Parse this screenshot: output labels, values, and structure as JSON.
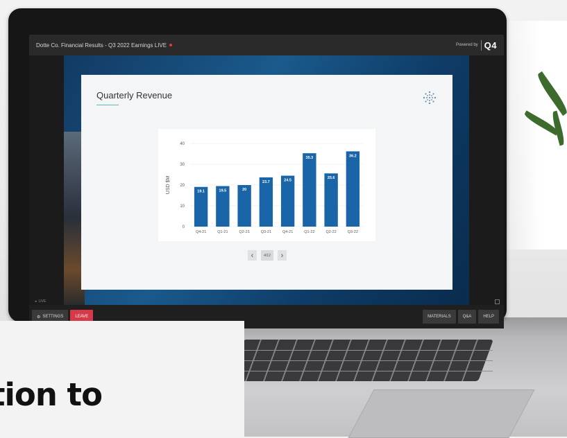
{
  "event": {
    "title": "Dotte Co. Financial Results - Q3 2022 Earnings LIVE",
    "powered_by": "Powered by",
    "provider_logo": "Q4"
  },
  "slide": {
    "title": "Quarterly Revenue",
    "brand_icon": "snowflake-logo-icon",
    "page_indicator": "4/12",
    "prev_icon": "chevron-left-icon",
    "next_icon": "chevron-right-icon"
  },
  "chart_data": {
    "type": "bar",
    "title": "",
    "xlabel": "",
    "ylabel": "USD $M",
    "categories": [
      "Q4-21",
      "Q1-21",
      "Q2-21",
      "Q3-21",
      "Q4-21",
      "Q1-22",
      "Q2-22",
      "Q3-22"
    ],
    "values": [
      19.1,
      19.5,
      20,
      23.7,
      24.5,
      35.3,
      25.6,
      36.2
    ],
    "value_labels": [
      "19.1",
      "19.5",
      "20",
      "23.7",
      "24.5",
      "35.3",
      "25.6",
      "36.2"
    ],
    "yticks": [
      "0",
      "10",
      "20",
      "30",
      "40"
    ],
    "ylim": [
      0,
      40
    ],
    "grid": true,
    "bar_color": "#1a64a8"
  },
  "stage": {
    "live_label": "LIVE"
  },
  "controls": {
    "settings_label": "SETTINGS",
    "leave_label": "LEAVE",
    "materials_label": "MATERIALS",
    "qa_label": "Q&A",
    "help_label": "HELP"
  },
  "overlay": {
    "text": "tion to"
  },
  "colors": {
    "leave": "#d63a48",
    "accent_underline": "#5cb8b2",
    "bar": "#1a64a8"
  }
}
